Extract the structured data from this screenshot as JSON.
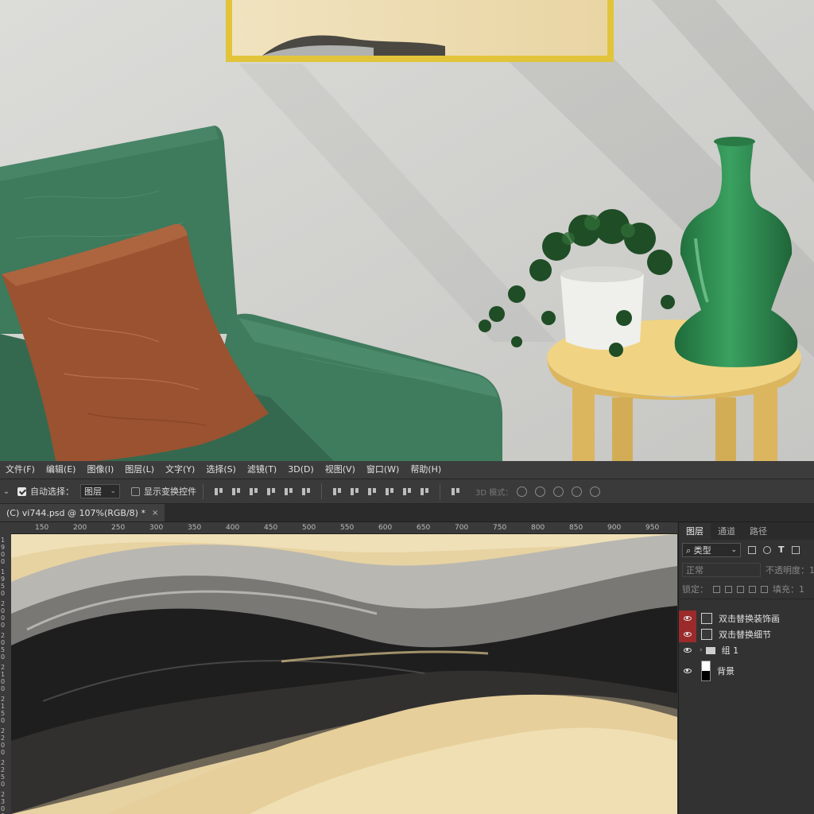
{
  "menubar": {
    "items": [
      "文件(F)",
      "编辑(E)",
      "图像(I)",
      "图层(L)",
      "文字(Y)",
      "选择(S)",
      "滤镜(T)",
      "3D(D)",
      "视图(V)",
      "窗口(W)",
      "帮助(H)"
    ]
  },
  "options": {
    "auto_select_label": "自动选择：",
    "auto_select_checked": true,
    "auto_select_target": "图层",
    "show_transform_label": "显示变换控件",
    "show_transform_checked": false,
    "mode_3d_label": "3D 模式："
  },
  "document_tab": {
    "title": "(C) vi744.psd @ 107%(RGB/8) *",
    "close": "×"
  },
  "ruler": {
    "h_ticks": [
      "150",
      "200",
      "250",
      "300",
      "350",
      "400",
      "450",
      "500",
      "550",
      "600",
      "650",
      "700",
      "750",
      "800",
      "850",
      "900",
      "950"
    ],
    "v_ticks": [
      "1900",
      "1950",
      "2000",
      "2050",
      "2100",
      "2150",
      "2200",
      "2250",
      "2300"
    ]
  },
  "layers_panel": {
    "tabs": [
      "图层",
      "通道",
      "路径"
    ],
    "active_tab": "图层",
    "filter_label": "类型",
    "blend_mode": "正常",
    "opacity_label": "不透明度：",
    "opacity_value": "1",
    "lock_label": "锁定：",
    "fill_label": "填充：",
    "fill_value": "1",
    "layers": [
      {
        "name": "双击替换装饰画",
        "visible": true,
        "highlight": true,
        "kind": "smart"
      },
      {
        "name": "双击替换细节",
        "visible": true,
        "highlight": true,
        "kind": "smart"
      },
      {
        "name": "组 1",
        "visible": true,
        "highlight": false,
        "kind": "group"
      },
      {
        "name": "背景",
        "visible": true,
        "highlight": false,
        "kind": "background"
      }
    ]
  },
  "colors": {
    "sofa": "#3e7a5c",
    "pillow": "#9a5230",
    "table": "#e9c873",
    "vase": "#2f8a4e",
    "frame": "#e2c43a",
    "ps_bg": "#323232",
    "layer_highlight": "#9b2a2a"
  }
}
